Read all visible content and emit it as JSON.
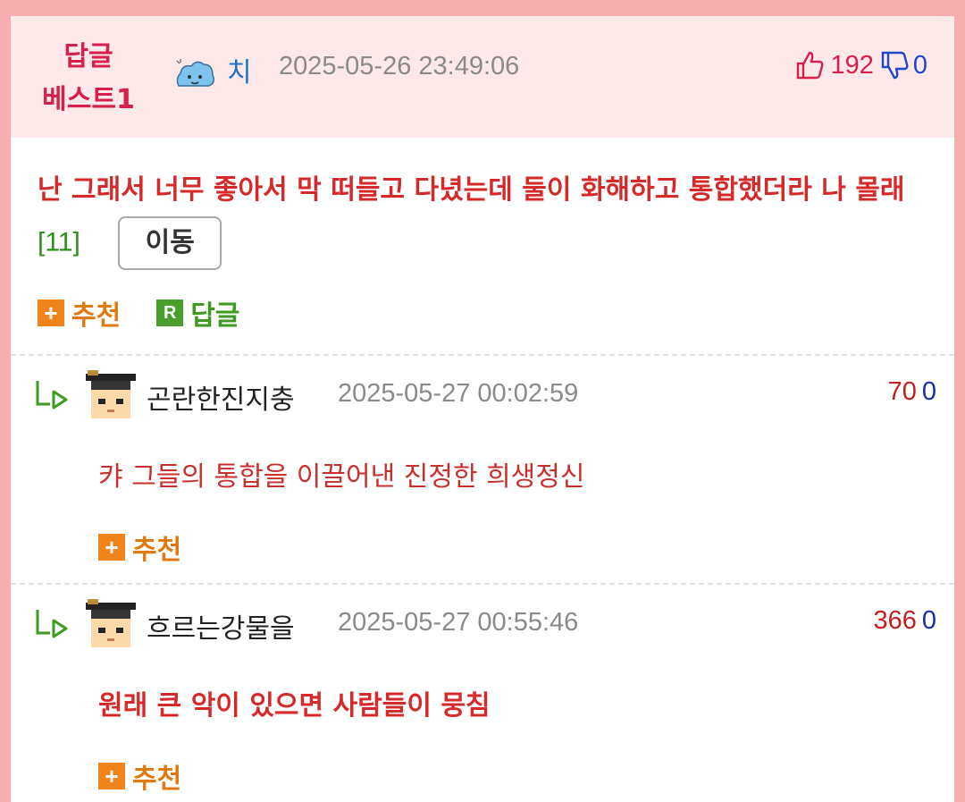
{
  "best": {
    "badge_line1": "답글",
    "badge_line2": "베스트1",
    "author": "치",
    "date": "2025-05-26 23:49:06",
    "up_count": "192",
    "down_count": "0"
  },
  "main_comment": {
    "text": "난 그래서 너무 좋아서 막 떠들고 다녔는데 둘이 화해하고 통합했더라 나 몰래",
    "reply_count": "[11]",
    "move_label": "이동",
    "recommend_label": "추천",
    "reply_label": "답글",
    "plus_symbol": "+",
    "reply_box_symbol": "R"
  },
  "replies": [
    {
      "author": "곤란한진지충",
      "date": "2025-05-27 00:02:59",
      "up": "70",
      "down": "0",
      "text": "캬 그들의 통합을 이끌어낸 진정한 희생정신",
      "recommend_label": "추천"
    },
    {
      "author": "흐르는강물을",
      "date": "2025-05-27 00:55:46",
      "up": "366",
      "down": "0",
      "text": "원래 큰 악이 있으면 사람들이 뭉침",
      "recommend_label": "추천"
    }
  ],
  "icons": {
    "thumb_up": "thumb-up-icon",
    "thumb_down": "thumb-down-icon",
    "reply_arrow": "reply-arrow-icon",
    "avatar": "graduate-avatar-icon",
    "author_icon": "cloud-creature-icon"
  },
  "colors": {
    "best_bg": "#fde9ea",
    "frame_border": "#f7aeb1",
    "accent_red": "#d62a2a",
    "orange": "#f0841a",
    "green": "#4a9e2c",
    "blue": "#1e73c9"
  }
}
